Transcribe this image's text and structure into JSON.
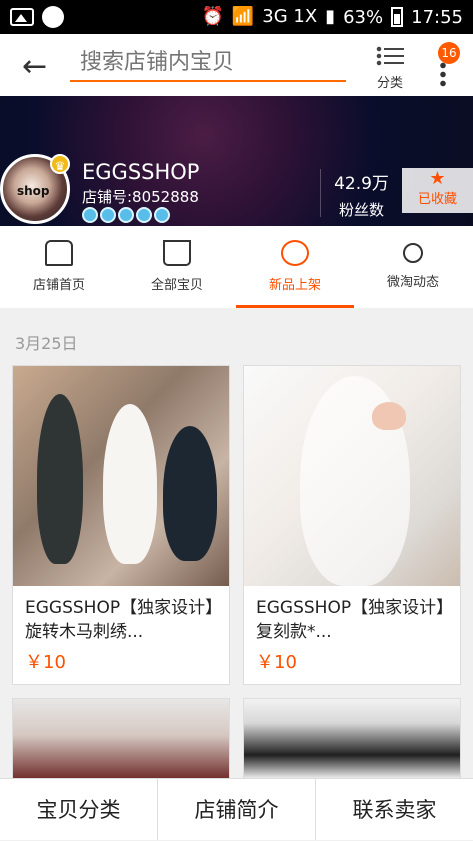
{
  "status_bar": {
    "battery_percent": "63%",
    "time": "17:55",
    "network": "3G 1X"
  },
  "search": {
    "placeholder": "搜索店铺内宝贝",
    "category_label": "分类",
    "notification_count": "16"
  },
  "shop": {
    "name": "EGGSSHOP",
    "shop_number": "店铺号:8052888",
    "logo_text": "shop",
    "fans_count": "42.9万",
    "fans_label": "粉丝数",
    "favorite_label": "已收藏",
    "diamond_count": 5
  },
  "tabs": [
    {
      "label": "店铺首页",
      "icon": "store-icon"
    },
    {
      "label": "全部宝贝",
      "icon": "bag-icon"
    },
    {
      "label": "新品上架",
      "icon": "new-products-icon",
      "active": true
    },
    {
      "label": "微淘动态",
      "icon": "broadcast-icon"
    }
  ],
  "section_date": "3月25日",
  "products": [
    {
      "title": "EGGSSHOP【独家设计】旋转木马刺绣...",
      "price": "￥10"
    },
    {
      "title": "EGGSSHOP【独家设计】复刻款*...",
      "price": "￥10"
    },
    {
      "title": "",
      "price": ""
    },
    {
      "title": "",
      "price": ""
    }
  ],
  "bottom_nav": [
    {
      "label": "宝贝分类"
    },
    {
      "label": "店铺简介"
    },
    {
      "label": "联系卖家"
    }
  ],
  "colors": {
    "accent": "#ff5000",
    "header_bg": "#0a0d2b"
  }
}
